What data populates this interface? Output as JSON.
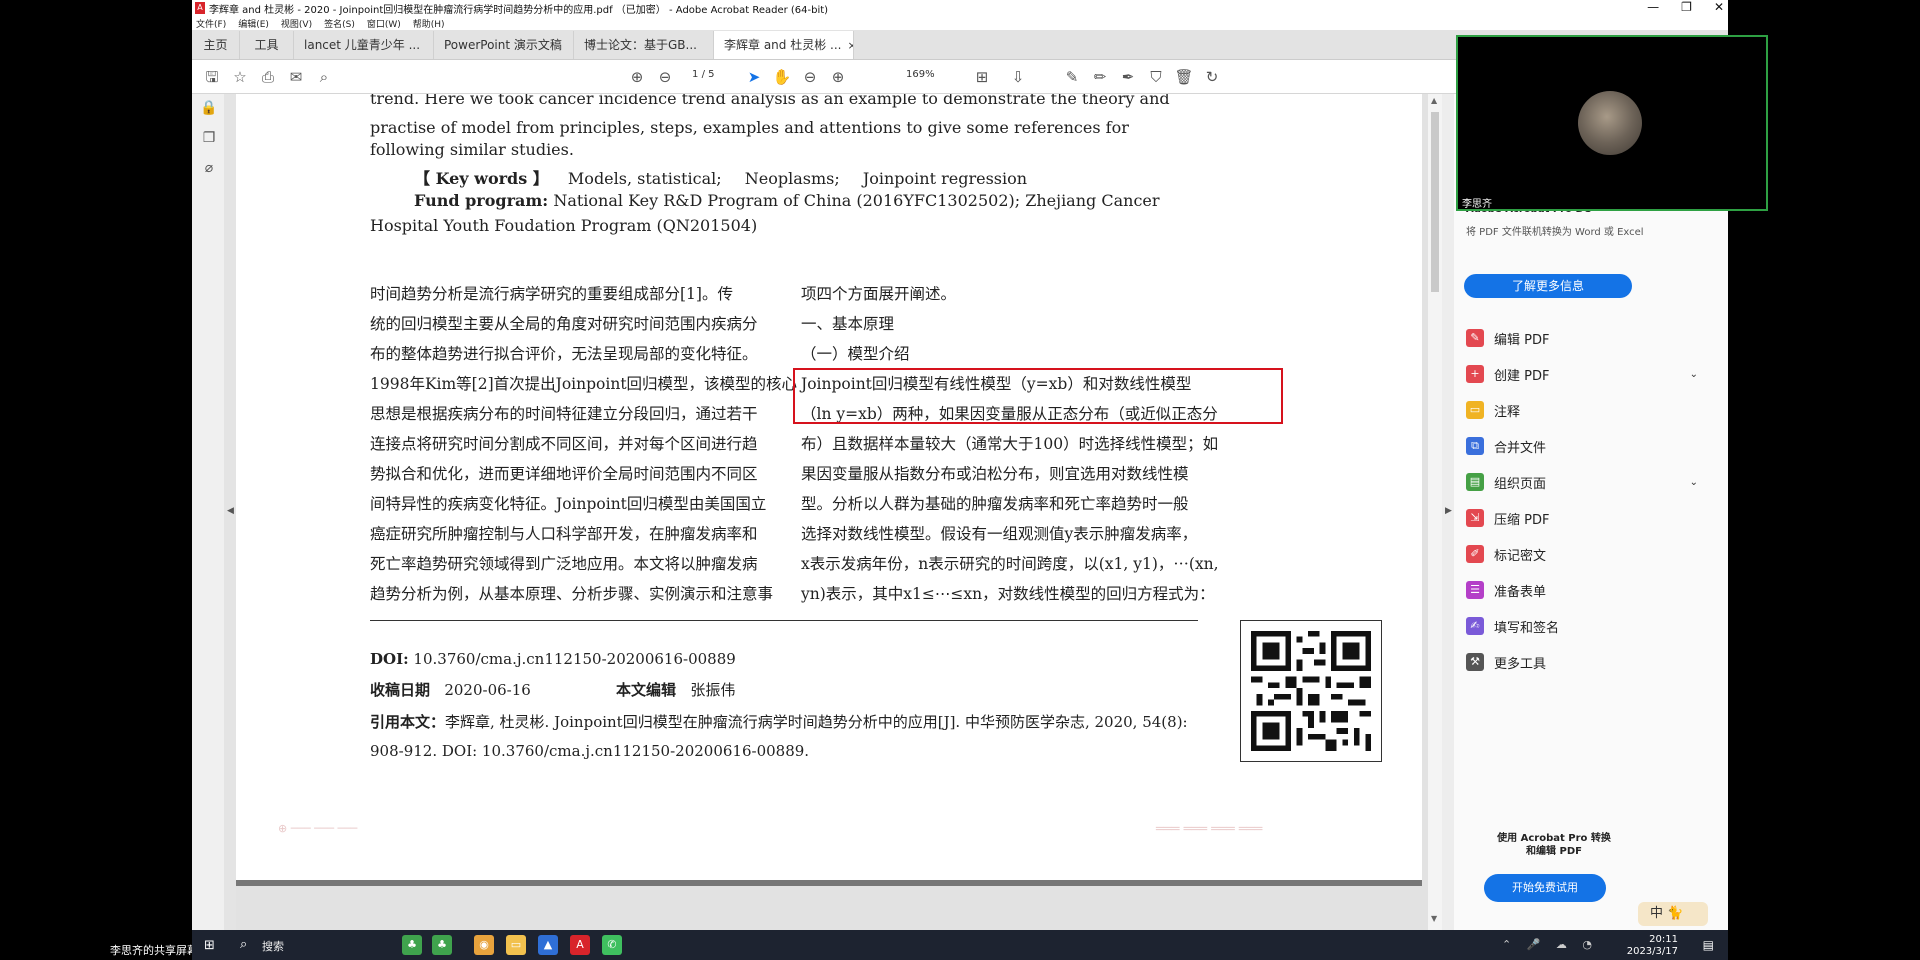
{
  "window": {
    "title": "李辉章 and 杜灵彬 - 2020 - Joinpoint回归模型在肿瘤流行病学时间趋势分析中的应用.pdf （已加密） - Adobe Acrobat Reader (64-bit)",
    "controls": [
      "—",
      "❐",
      "✕"
    ]
  },
  "menu": [
    "文件(F)",
    "编辑(E)",
    "视图(V)",
    "签名(S)",
    "窗口(W)",
    "帮助(H)"
  ],
  "tabs": {
    "home": "主页",
    "tools": "工具",
    "docs": [
      "lancet 儿童青少年 ...",
      "PowerPoint 演示文稿",
      "博士论文：基于GB..."
    ],
    "active": "李辉章 and 杜灵彬 ...",
    "close": "×"
  },
  "toolbar": {
    "page_current": "1",
    "page_total": "/ 5",
    "zoom": "169%"
  },
  "pdf": {
    "abstract_line1": "trend. Here we took cancer incidence trend analysis as an example to demonstrate the theory and",
    "abstract_line2": "practise of model from principles, steps, examples and attentions to give some references for",
    "abstract_line3": "following similar studies.",
    "keywords_label": "【 Key words 】",
    "keywords": [
      "Models, statistical;",
      "Neoplasms;",
      "Joinpoint regression"
    ],
    "fund_label": "Fund program:",
    "fund_text": "National Key R&D Program of China (2016YFC1302502); Zhejiang Cancer",
    "fund_cont": "Hospital Youth Foudation Program (QN201504)",
    "left_col": [
      "    时间趋势分析是流行病学研究的重要组成部分[1]。传",
      "统的回归模型主要从全局的角度对研究时间范围内疾病分",
      "布的整体趋势进行拟合评价，无法呈现局部的变化特征。",
      "1998年Kim等[2]首次提出Joinpoint回归模型，该模型的核心",
      "思想是根据疾病分布的时间特征建立分段回归，通过若干",
      "连接点将研究时间分割成不同区间，并对每个区间进行趋",
      "势拟合和优化，进而更详细地评价全局时间范围内不同区",
      "间特异性的疾病变化特征。Joinpoint回归模型由美国国立",
      "癌症研究所肿瘤控制与人口科学部开发，在肿瘤发病率和",
      "死亡率趋势研究领域得到广泛地应用。本文将以肿瘤发病",
      "趋势分析为例，从基本原理、分析步骤、实例演示和注意事"
    ],
    "right_col": [
      "项四个方面展开阐述。",
      "    一、基本原理",
      "    （一）模型介绍",
      "    Joinpoint回归模型有线性模型（y=xb）和对数线性模型",
      "（ln y=xb）两种，如果因变量服从正态分布（或近似正态分",
      "布）且数据样本量较大（通常大于100）时选择线性模型；如",
      "果因变量服从指数分布或泊松分布，则宜选用对数线性模",
      "型。分析以人群为基础的肿瘤发病率和死亡率趋势时一般",
      "选择对数线性模型。假设有一组观测值y表示肿瘤发病率，",
      "x表示发病年份，n表示研究的时间跨度，以(x1, y1)，⋯(xn,",
      "yn)表示，其中x1≤⋯≤xn，对数线性模型的回归方程式为："
    ],
    "doi_label": "DOI:",
    "doi": "10.3760/cma.j.cn112150-20200616-00889",
    "received_label": "收稿日期",
    "received": "2020-06-16",
    "editor_label": "本文编辑",
    "editor": "张振伟",
    "cite_label": "引用本文：",
    "cite_text": "李辉章, 杜灵彬. Joinpoint回归模型在肿瘤流行病学时间趋势分析中的应用[J]. 中华预防医学杂志, 2020, 54(8): 908-912. DOI: 10.3760/cma.j.cn112150-20200616-00889."
  },
  "right_panel": {
    "title": "Adobe Acrobat Pro DC",
    "subtitle": "将 PDF 文件联机转换为 Word 或 Excel",
    "learn_more": "了解更多信息",
    "tools": [
      {
        "label": "编辑 PDF",
        "color": "#e34850",
        "chevron": false
      },
      {
        "label": "创建 PDF",
        "color": "#e34850",
        "chevron": true
      },
      {
        "label": "注释",
        "color": "#f0b323",
        "chevron": false
      },
      {
        "label": "合并文件",
        "color": "#3a6fdc",
        "chevron": false
      },
      {
        "label": "组织页面",
        "color": "#45a045",
        "chevron": true
      },
      {
        "label": "压缩 PDF",
        "color": "#e34850",
        "chevron": false
      },
      {
        "label": "标记密文",
        "color": "#e34850",
        "chevron": false
      },
      {
        "label": "准备表单",
        "color": "#b43fc8",
        "chevron": false
      },
      {
        "label": "填写和签名",
        "color": "#7a5ad8",
        "chevron": false
      },
      {
        "label": "更多工具",
        "color": "#555555",
        "chevron": false
      }
    ],
    "promo": "使用 Acrobat Pro 转换和编辑 PDF",
    "trial": "开始免费试用"
  },
  "video": {
    "name": "李思齐"
  },
  "share_label": "李思齐的共享屏幕",
  "ime": "中 🐈",
  "taskbar": {
    "search": "搜索",
    "time": "20:11",
    "date": "2023/3/17"
  }
}
